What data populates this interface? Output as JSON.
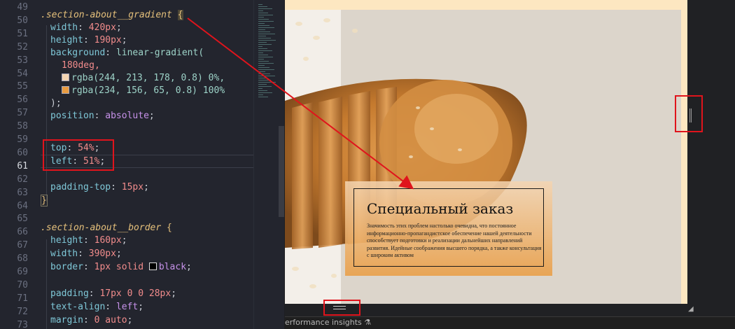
{
  "editor": {
    "line_numbers": [
      "49",
      "50",
      "51",
      "52",
      "53",
      "54",
      "55",
      "56",
      "57",
      "58",
      "59",
      "60",
      "61",
      "62",
      "63",
      "64",
      "65",
      "66",
      "67",
      "68",
      "69",
      "70",
      "71",
      "72",
      "73"
    ],
    "active_line": "61",
    "lines": {
      "l50_selector": ".section-about__gradient",
      "l50_brace": "{",
      "l51_prop": "width",
      "l51_val": "420px",
      "l52_prop": "height",
      "l52_val": "190px",
      "l53_prop": "background",
      "l53_fn": "linear-gradient(",
      "l54_val": "180deg,",
      "l55_val": "rgba(244, 213, 178, 0.8) 0%,",
      "l56_val": "rgba(234, 156, 65, 0.8) 100%",
      "l57_val": ");",
      "l58_prop": "position",
      "l58_val": "absolute",
      "l60_prop": "top",
      "l60_val": "54%",
      "l61_prop": "left",
      "l61_val": "51%",
      "l63_prop": "padding-top",
      "l63_val": "15px",
      "l64_brace": "}",
      "l66_selector": ".section-about__border",
      "l66_brace": "{",
      "l67_prop": "height",
      "l67_val": "160px",
      "l68_prop": "width",
      "l68_val": "390px",
      "l69_prop": "border",
      "l69_val": "1px solid",
      "l69_color": "black",
      "l71_prop": "padding",
      "l71_val": "17px 0 0 28px",
      "l72_prop": "text-align",
      "l72_val": "left",
      "l73_prop": "margin",
      "l73_val": "0 auto"
    },
    "swatch_colors": {
      "l55": "#f4d5b2",
      "l56": "#ea9c41",
      "l69": "#000000"
    }
  },
  "preview": {
    "card_title": "Специальный заказ",
    "card_body": "Значимость этих проблем настолько очевидна, что постоянное информационно-пропагандистское обеспечение нашей деятельности способствует подготовки и реализации дальнейших направлений развития. Идейные соображения высшего порядка, а также консультация с широким активом"
  },
  "devtools": {
    "tab_label": "erformance insights",
    "tab_icon": "flask-icon"
  },
  "colors": {
    "annotation_red": "#e0141c",
    "editor_bg": "#23252e",
    "preview_bg": "#fde7c1"
  }
}
